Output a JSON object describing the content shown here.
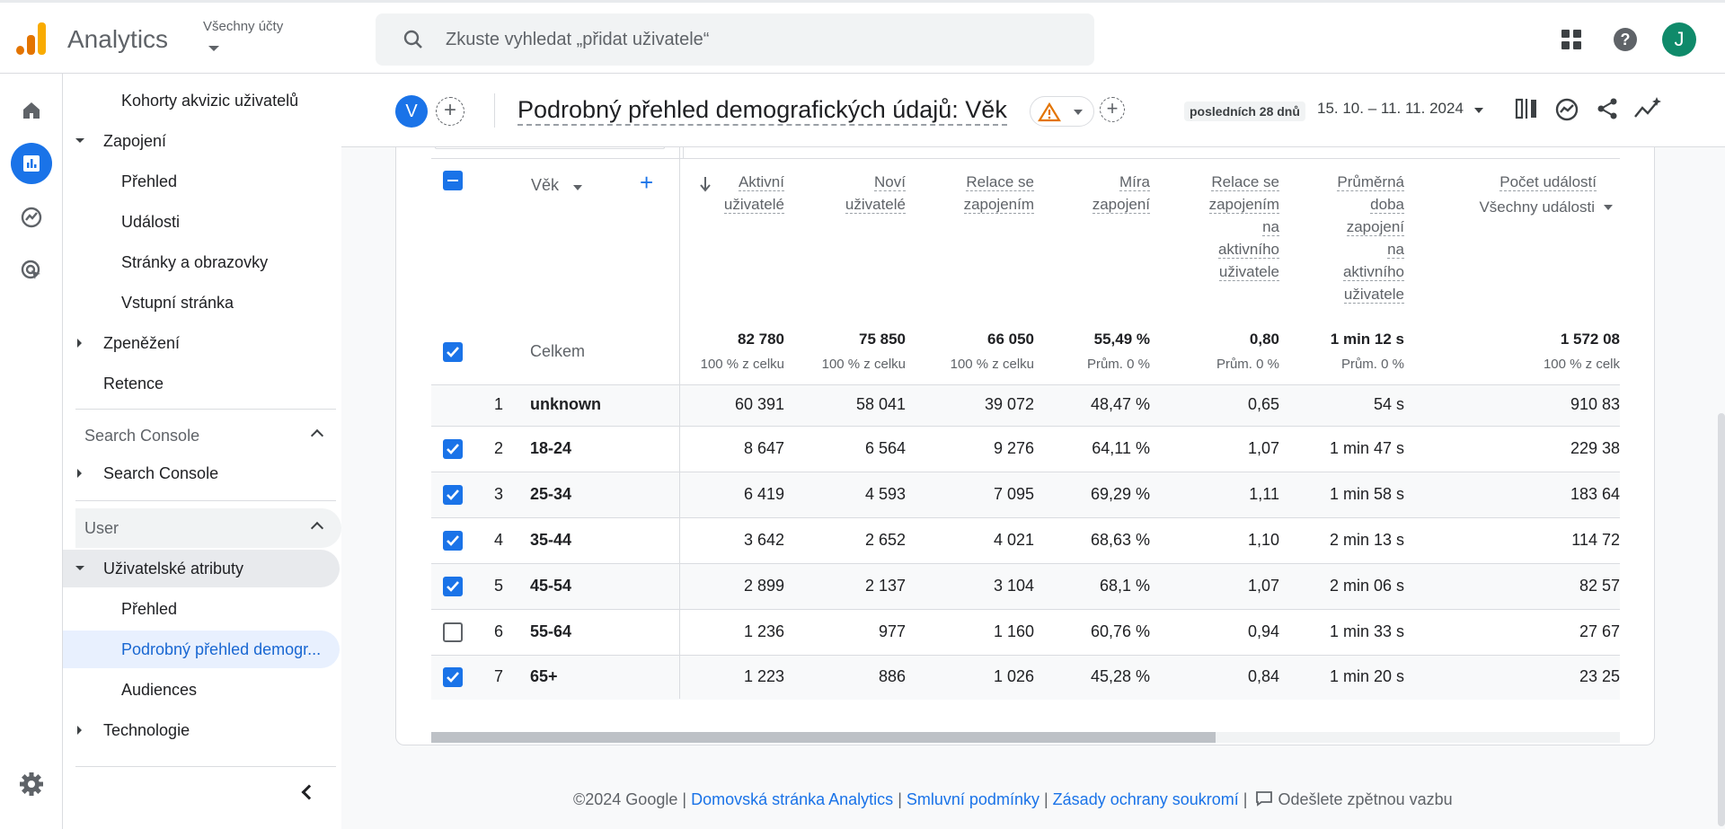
{
  "app": {
    "name": "Analytics",
    "account_label": "Všechny účty",
    "search_placeholder": "Zkuste vyhledat „přidat uživatele“",
    "avatar_letter": "J",
    "brand_colors": {
      "orange": "#f9ab00",
      "dark_orange": "#e37400",
      "blue": "#1a73e8"
    }
  },
  "nav": {
    "items": [
      {
        "label": "Kohorty akvizic uživatelů",
        "level": 2
      },
      {
        "label": "Zapojení",
        "level": 1,
        "expanded": true
      },
      {
        "label": "Přehled",
        "level": 2
      },
      {
        "label": "Události",
        "level": 2
      },
      {
        "label": "Stránky a obrazovky",
        "level": 2
      },
      {
        "label": "Vstupní stránka",
        "level": 2
      },
      {
        "label": "Zpeněžení",
        "level": 1,
        "expanded": false
      },
      {
        "label": "Retence",
        "level": 1
      }
    ],
    "section_search_console": "Search Console",
    "search_console_item": "Search Console",
    "section_user": "User",
    "user_items": [
      {
        "label": "Uživatelské atributy",
        "level": 1,
        "expanded": true
      },
      {
        "label": "Přehled",
        "level": 2
      },
      {
        "label": "Podrobný přehled demogr...",
        "level": 2,
        "selected": true
      },
      {
        "label": "Audiences",
        "level": 2
      },
      {
        "label": "Technologie",
        "level": 1,
        "expanded": false
      }
    ]
  },
  "report": {
    "badge": "V",
    "title": "Podrobný přehled demografických údajů: Věk",
    "date_chip": "posledních 28 dnů",
    "date_range": "15. 10. – 11. 11. 2024"
  },
  "table": {
    "dimension_header": "Věk",
    "columns": [
      {
        "lines": [
          "Aktivní",
          "uživatelé"
        ]
      },
      {
        "lines": [
          "Noví",
          "uživatelé"
        ]
      },
      {
        "lines": [
          "Relace se",
          "zapojením"
        ]
      },
      {
        "lines": [
          "Míra",
          "zapojení"
        ]
      },
      {
        "lines": [
          "Relace se",
          "zapojením",
          "na",
          "aktivního",
          "uživatele"
        ]
      },
      {
        "lines": [
          "Průměrná",
          "doba",
          "zapojení",
          "na",
          "aktivního",
          "uživatele"
        ]
      },
      {
        "lines": [
          "Počet událostí"
        ],
        "filter": "Všechny události"
      }
    ],
    "totals_label": "Celkem",
    "totals": [
      "82 780",
      "75 850",
      "66 050",
      "55,49 %",
      "0,80",
      "1 min 12 s",
      "1 572 08"
    ],
    "totals_sub": [
      "100 % z celku",
      "100 % z celku",
      "100 % z celku",
      "Prům. 0 %",
      "Prům. 0 %",
      "Prům. 0 %",
      "100 % z celk"
    ],
    "rows": [
      {
        "index": "1",
        "dim": "unknown",
        "checked": null,
        "values": [
          "60 391",
          "58 041",
          "39 072",
          "48,47 %",
          "0,65",
          "54 s",
          "910 83"
        ]
      },
      {
        "index": "2",
        "dim": "18-24",
        "checked": true,
        "values": [
          "8 647",
          "6 564",
          "9 276",
          "64,11 %",
          "1,07",
          "1 min 47 s",
          "229 38"
        ]
      },
      {
        "index": "3",
        "dim": "25-34",
        "checked": true,
        "values": [
          "6 419",
          "4 593",
          "7 095",
          "69,29 %",
          "1,11",
          "1 min 58 s",
          "183 64"
        ]
      },
      {
        "index": "4",
        "dim": "35-44",
        "checked": true,
        "values": [
          "3 642",
          "2 652",
          "4 021",
          "68,63 %",
          "1,10",
          "2 min 13 s",
          "114 72"
        ]
      },
      {
        "index": "5",
        "dim": "45-54",
        "checked": true,
        "values": [
          "2 899",
          "2 137",
          "3 104",
          "68,1 %",
          "1,07",
          "2 min 06 s",
          "82 57"
        ]
      },
      {
        "index": "6",
        "dim": "55-64",
        "checked": false,
        "values": [
          "1 236",
          "977",
          "1 160",
          "60,76 %",
          "0,94",
          "1 min 33 s",
          "27 67"
        ]
      },
      {
        "index": "7",
        "dim": "65+",
        "checked": true,
        "values": [
          "1 223",
          "886",
          "1 026",
          "45,28 %",
          "0,84",
          "1 min 20 s",
          "23 25"
        ]
      }
    ]
  },
  "footer": {
    "copyright": "©2024 Google",
    "sep": "|",
    "link1": "Domovská stránka Analytics",
    "link2": "Smluvní podmínky",
    "link3": "Zásady ochrany soukromí",
    "feedback": "Odešlete zpětnou vazbu"
  }
}
